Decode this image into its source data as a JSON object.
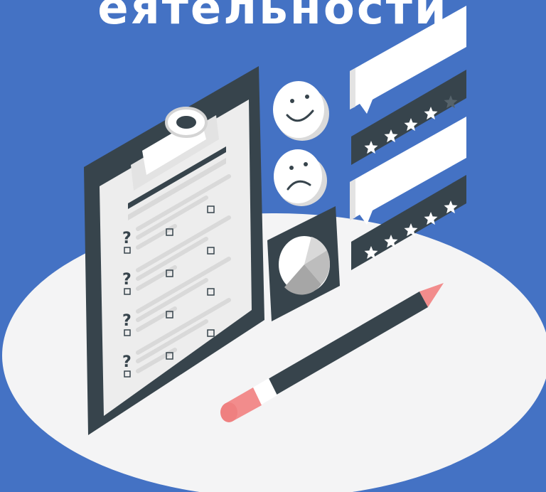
{
  "headline": "еятельности",
  "colors": {
    "background": "#4472C4",
    "platform": "#F4F4F5",
    "dark": "#37444C",
    "paper": "#EDEDED",
    "line": "#D9D9D9",
    "white": "#FFFFFF",
    "star": "#FFFFFF",
    "star_dim": "#56636B",
    "pencil_tip": "#F28C8C",
    "pencil_eraser": "#F28C8C"
  },
  "illustration": {
    "checklist_rows": 4,
    "rating_cards": [
      {
        "stars_filled": 4,
        "stars_total": 5
      },
      {
        "stars_filled": 5,
        "stars_total": 5
      }
    ],
    "faces": [
      "smile-icon",
      "sad-icon"
    ]
  }
}
